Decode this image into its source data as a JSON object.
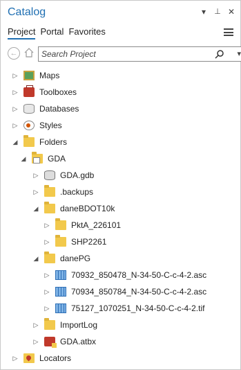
{
  "panel": {
    "title": "Catalog",
    "title_icons": {
      "dropdown": "▾",
      "pin": "📌",
      "close": "✕"
    }
  },
  "tabs": [
    {
      "label": "Project",
      "active": true
    },
    {
      "label": "Portal",
      "active": false
    },
    {
      "label": "Favorites",
      "active": false
    }
  ],
  "search": {
    "placeholder": "Search Project",
    "value": ""
  },
  "tree": [
    {
      "label": "Maps",
      "icon": "maps-icon",
      "expander": "▷"
    },
    {
      "label": "Toolboxes",
      "icon": "toolboxes-icon",
      "expander": "▷"
    },
    {
      "label": "Databases",
      "icon": "databases-icon",
      "expander": "▷"
    },
    {
      "label": "Styles",
      "icon": "styles-icon",
      "expander": "▷"
    },
    {
      "label": "Folders",
      "icon": "folders-icon",
      "expander": "◢"
    },
    {
      "label": "GDA",
      "icon": "folder-home-icon",
      "expander": "◢"
    },
    {
      "label": "GDA.gdb",
      "icon": "geodatabase-icon",
      "expander": "▷"
    },
    {
      "label": ".backups",
      "icon": "folder-icon",
      "expander": "▷"
    },
    {
      "label": "daneBDOT10k",
      "icon": "folder-icon",
      "expander": "◢"
    },
    {
      "label": "PktA_226101",
      "icon": "folder-icon",
      "expander": "▷"
    },
    {
      "label": "SHP2261",
      "icon": "folder-icon",
      "expander": "▷"
    },
    {
      "label": "danePG",
      "icon": "folder-icon",
      "expander": "◢"
    },
    {
      "label": "70932_850478_N-34-50-C-c-4-2.asc",
      "icon": "raster-icon",
      "expander": "▷"
    },
    {
      "label": "70934_850784_N-34-50-C-c-4-2.asc",
      "icon": "raster-icon",
      "expander": "▷"
    },
    {
      "label": "75127_1070251_N-34-50-C-c-4-2.tif",
      "icon": "raster-icon",
      "expander": "▷"
    },
    {
      "label": "ImportLog",
      "icon": "folder-icon",
      "expander": "▷"
    },
    {
      "label": "GDA.atbx",
      "icon": "toolbox-file-icon",
      "expander": "▷"
    },
    {
      "label": "Locators",
      "icon": "locators-icon",
      "expander": "▷"
    }
  ]
}
